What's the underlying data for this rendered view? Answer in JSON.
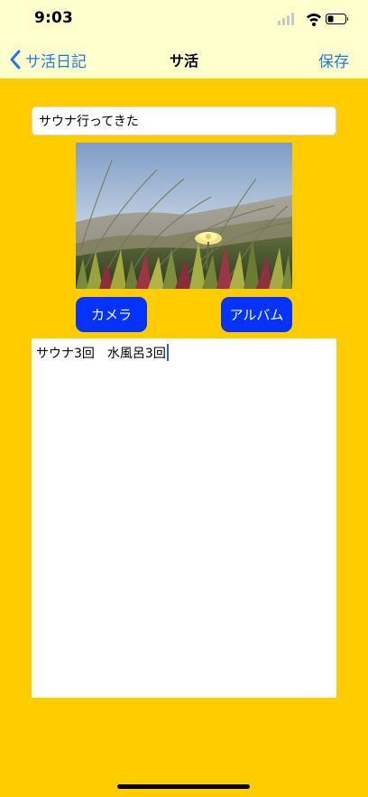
{
  "status_bar": {
    "time": "9:03"
  },
  "nav": {
    "back_label": "サ活日記",
    "title": "サ活",
    "save_label": "保存"
  },
  "form": {
    "title_value": "サウナ行ってきた",
    "photo_description": "photo",
    "camera_label": "カメラ",
    "album_label": "アルバム",
    "memo_text": "サウナ3回　水風呂3回"
  },
  "colors": {
    "background": "#FFCC00",
    "nav_background": "#FFFFCE",
    "accent": "#1E7BE6",
    "button": "#0433FF"
  }
}
